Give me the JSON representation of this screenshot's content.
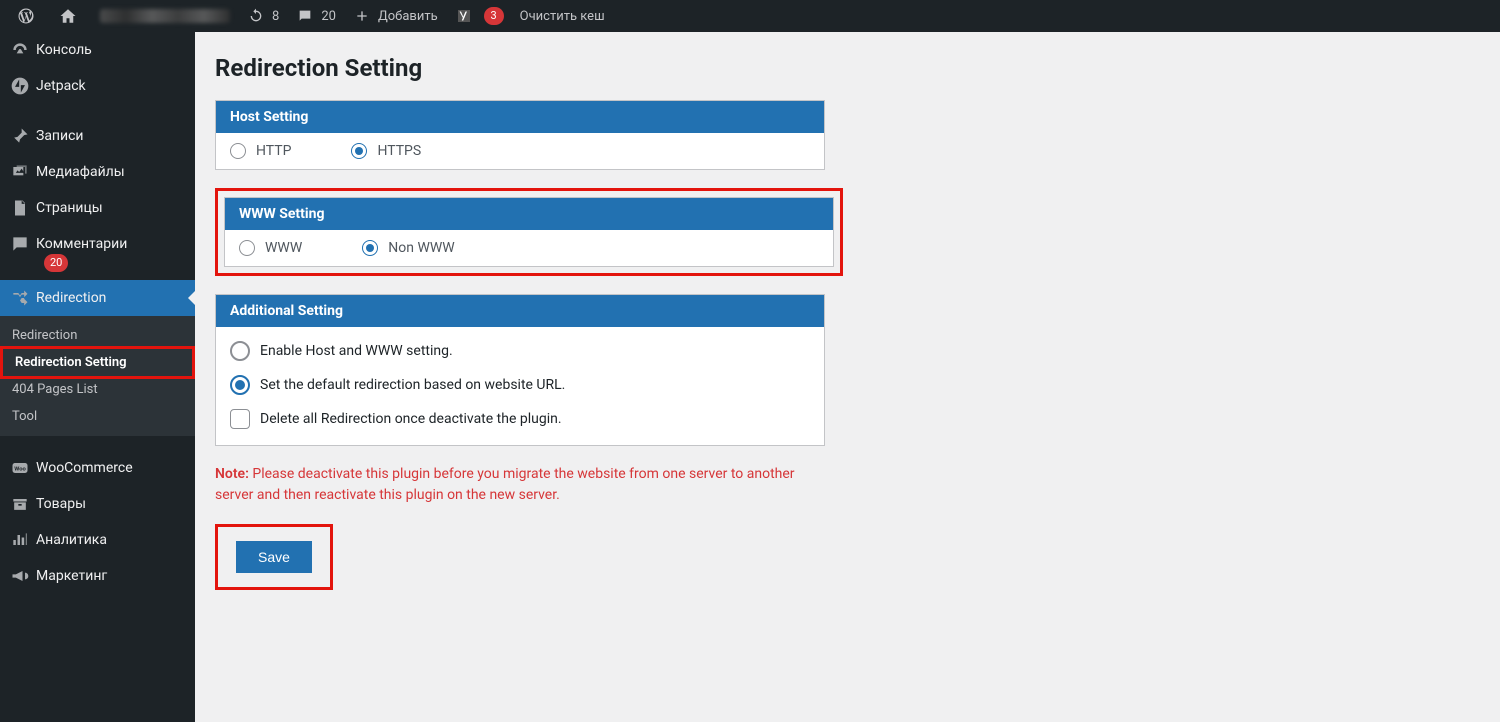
{
  "topbar": {
    "updates_count": "8",
    "comments_count": "20",
    "add_label": "Добавить",
    "yoast_count": "3",
    "clear_cache": "Очистить кеш"
  },
  "sidebar": {
    "items": [
      {
        "label": "Консоль",
        "icon": "dashboard"
      },
      {
        "label": "Jetpack",
        "icon": "jetpack"
      },
      {
        "label": "Записи",
        "icon": "pin"
      },
      {
        "label": "Медиафайлы",
        "icon": "media"
      },
      {
        "label": "Страницы",
        "icon": "page"
      },
      {
        "label": "Комментарии",
        "icon": "comment",
        "badge": "20"
      },
      {
        "label": "Redirection",
        "icon": "shuffle",
        "active": true
      },
      {
        "label": "WooCommerce",
        "icon": "woo"
      },
      {
        "label": "Товары",
        "icon": "archive"
      },
      {
        "label": "Аналитика",
        "icon": "analytics"
      },
      {
        "label": "Маркетинг",
        "icon": "megaphone"
      }
    ],
    "submenu": [
      "Redirection",
      "Redirection Setting",
      "404 Pages List",
      "Tool"
    ]
  },
  "page": {
    "title": "Redirection Setting",
    "host_panel_title": "Host Setting",
    "host_options": {
      "a": "HTTP",
      "b": "HTTPS"
    },
    "www_panel_title": "WWW Setting",
    "www_options": {
      "a": "WWW",
      "b": "Non WWW"
    },
    "additional_title": "Additional Setting",
    "additional": {
      "opt1": "Enable Host and WWW setting.",
      "opt2": "Set the default redirection based on website URL.",
      "opt3": "Delete all Redirection once deactivate the plugin."
    },
    "note_label": "Note:",
    "note_text": " Please deactivate this plugin before you migrate the website from one server to another server and then reactivate this plugin on the new server.",
    "save": "Save"
  }
}
